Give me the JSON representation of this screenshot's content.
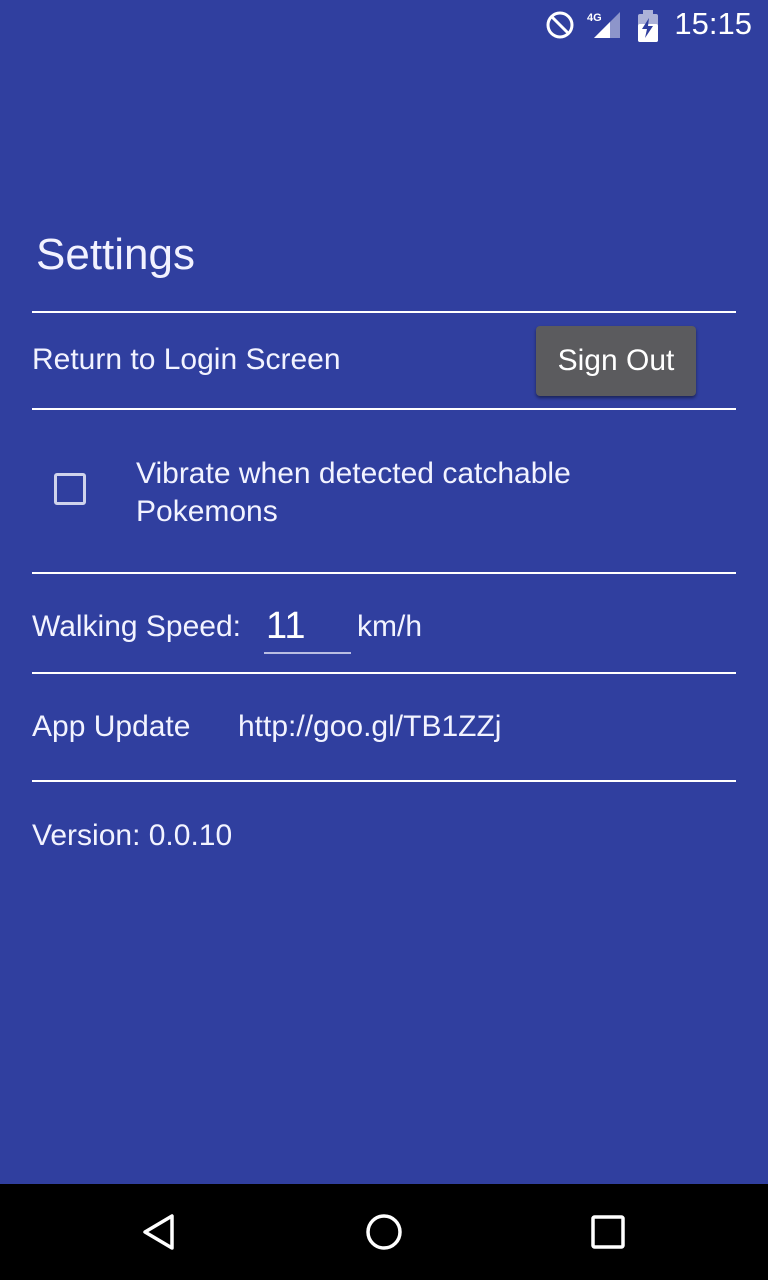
{
  "status_bar": {
    "time": "15:15",
    "network": "4G",
    "icons": [
      "do-not-disturb-icon",
      "signal-icon",
      "battery-charging-icon"
    ]
  },
  "settings": {
    "title": "Settings",
    "login": {
      "label": "Return to Login Screen",
      "button_label": "Sign Out"
    },
    "vibrate": {
      "label": "Vibrate when detected catchable Pokemons",
      "checked": false
    },
    "walking_speed": {
      "label": "Walking Speed:",
      "value": "11",
      "unit": "km/h"
    },
    "app_update": {
      "label": "App Update",
      "link": "http://goo.gl/TB1ZZj"
    },
    "version": "Version: 0.0.10"
  },
  "nav_bar": {
    "buttons": [
      "back-icon",
      "home-icon",
      "recents-icon"
    ]
  },
  "colors": {
    "background": "#303f9f",
    "button": "#5b5b5e",
    "nav_bar": "#000000"
  }
}
